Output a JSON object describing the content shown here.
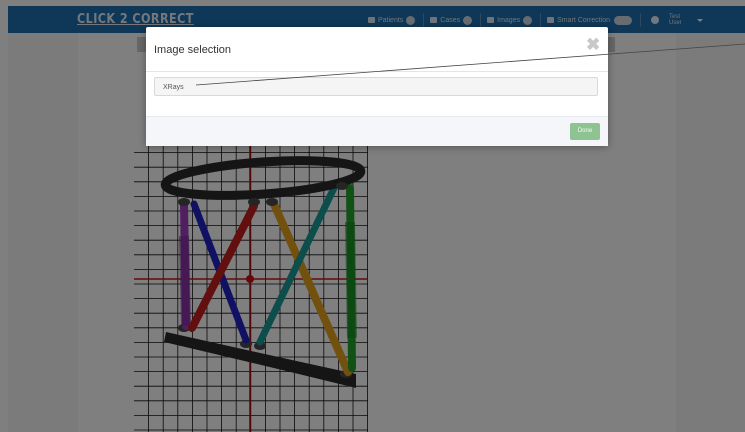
{
  "app": {
    "logo": "CLICK 2 CORRECT",
    "nav": {
      "patients": "Patients",
      "cases": "Cases",
      "images": "Images",
      "smart_correction": "Smart Correction",
      "user_line1": "Test",
      "user_line2": "User"
    }
  },
  "modal": {
    "title": "Image selection",
    "close_symbol": "✖",
    "select_value": "XRays",
    "done_label": "Done"
  },
  "icons": {
    "patients": "users-icon",
    "cases": "briefcase-icon",
    "images": "image-icon",
    "smart_correction": "calculator-icon",
    "info": "info-icon",
    "caret": "caret-down-icon"
  },
  "colors": {
    "navbar": "#1f6fae",
    "done_button": "#8fc392",
    "grid_line": "#111111",
    "crosshair": "#cc1111",
    "strut_purple": "#a23fbf",
    "strut_blue": "#2323c8",
    "strut_red": "#c81e1e",
    "strut_orange": "#e3a21a",
    "strut_teal": "#1b9a96",
    "strut_green": "#22a32c",
    "ring": "#2a2a2a"
  }
}
